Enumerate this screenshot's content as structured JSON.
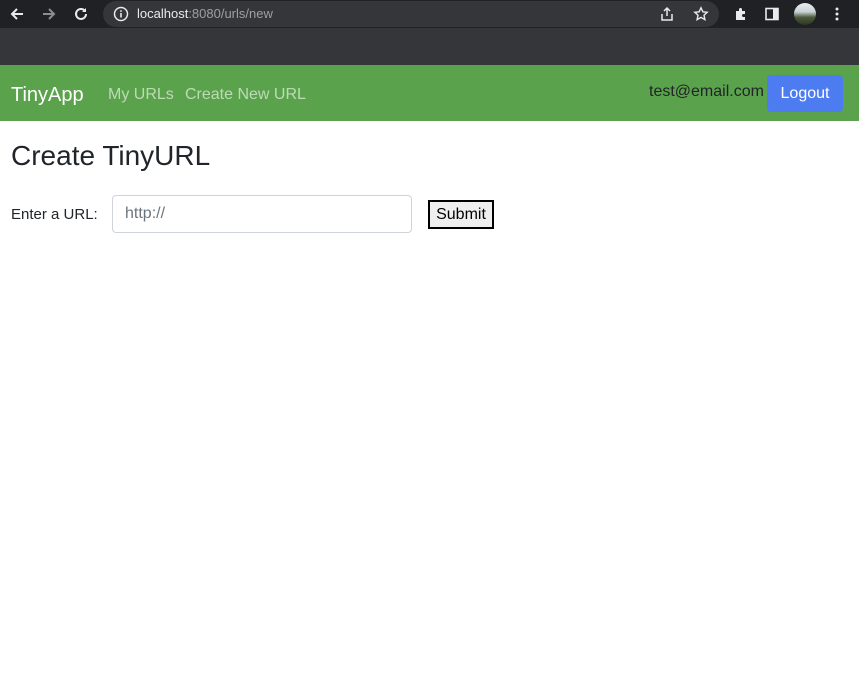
{
  "browser": {
    "url_host": "localhost",
    "url_rest": ":8080/urls/new",
    "icons": [
      "back-arrow-icon",
      "forward-arrow-icon",
      "reload-icon",
      "info-icon",
      "share-icon",
      "star-icon",
      "extensions-icon",
      "side-panel-icon",
      "profile-avatar",
      "kebab-menu-icon"
    ]
  },
  "navbar": {
    "brand": "TinyApp",
    "links": [
      "My URLs",
      "Create New URL"
    ],
    "user_email": "test@email.com",
    "logout_label": "Logout",
    "color": "#5aa24b"
  },
  "main": {
    "title": "Create TinyURL",
    "url_label": "Enter a URL:",
    "url_placeholder": "http://",
    "url_value": "",
    "submit_label": "Submit"
  },
  "colors": {
    "accent_button": "#4d7cf0",
    "chrome_dark": "#202124"
  }
}
